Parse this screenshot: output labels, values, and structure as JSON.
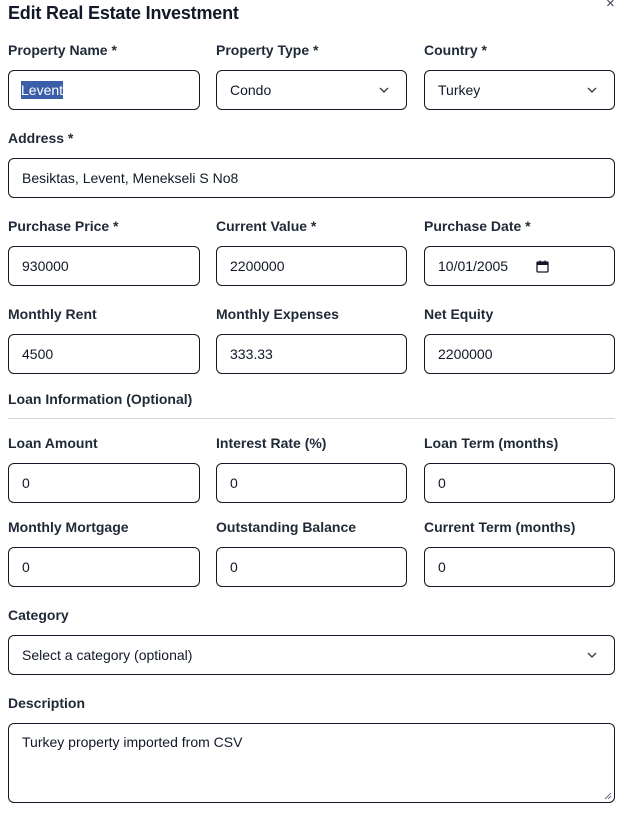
{
  "dialog": {
    "title": "Edit Real Estate Investment",
    "close_icon": "×"
  },
  "fields": {
    "property_name": {
      "label": "Property Name *",
      "value": "Levent"
    },
    "property_type": {
      "label": "Property Type *",
      "value": "Condo"
    },
    "country": {
      "label": "Country *",
      "value": "Turkey"
    },
    "address": {
      "label": "Address *",
      "value": "Besiktas, Levent, Menekseli S No8"
    },
    "purchase_price": {
      "label": "Purchase Price *",
      "value": "930000"
    },
    "current_value": {
      "label": "Current Value *",
      "value": "2200000"
    },
    "purchase_date": {
      "label": "Purchase Date *",
      "value": "10/01/2005"
    },
    "monthly_rent": {
      "label": "Monthly Rent",
      "value": "4500"
    },
    "monthly_expenses": {
      "label": "Monthly Expenses",
      "value": "333.33"
    },
    "net_equity": {
      "label": "Net Equity",
      "value": "2200000"
    }
  },
  "loan": {
    "heading": "Loan Information (Optional)",
    "loan_amount": {
      "label": "Loan Amount",
      "value": "0"
    },
    "interest_rate": {
      "label": "Interest Rate (%)",
      "value": "0"
    },
    "loan_term": {
      "label": "Loan Term (months)",
      "value": "0"
    },
    "monthly_mortgage": {
      "label": "Monthly Mortgage",
      "value": "0"
    },
    "outstanding_balance": {
      "label": "Outstanding Balance",
      "value": "0"
    },
    "current_term": {
      "label": "Current Term (months)",
      "value": "0"
    }
  },
  "category": {
    "label": "Category",
    "value": "Select a category (optional)"
  },
  "description": {
    "label": "Description",
    "value": "Turkey property imported from CSV"
  },
  "colors": {
    "selection": "#3b5ea8",
    "border": "#111827",
    "divider": "#d1d5db"
  },
  "icons": [
    "close-icon",
    "chevron-down-icon",
    "calendar-icon",
    "resize-grip-icon"
  ]
}
